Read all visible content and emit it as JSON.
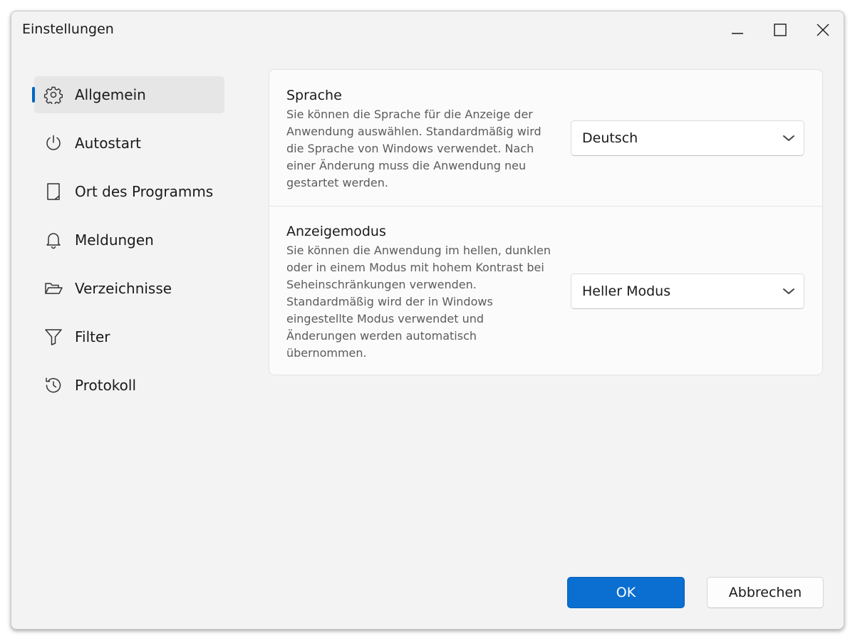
{
  "window": {
    "title": "Einstellungen"
  },
  "sidebar": {
    "items": [
      {
        "label": "Allgemein",
        "icon": "gear-icon",
        "active": true
      },
      {
        "label": "Autostart",
        "icon": "power-icon",
        "active": false
      },
      {
        "label": "Ort des Programms",
        "icon": "document-icon",
        "active": false
      },
      {
        "label": "Meldungen",
        "icon": "bell-icon",
        "active": false
      },
      {
        "label": "Verzeichnisse",
        "icon": "folder-open-icon",
        "active": false
      },
      {
        "label": "Filter",
        "icon": "filter-icon",
        "active": false
      },
      {
        "label": "Protokoll",
        "icon": "history-icon",
        "active": false
      }
    ]
  },
  "settings": {
    "language": {
      "title": "Sprache",
      "description": "Sie können die Sprache für die Anzeige der Anwendung auswählen. Standardmäßig wird die Sprache von Windows verwendet. Nach einer Änderung muss die Anwendung neu gestartet werden.",
      "value": "Deutsch"
    },
    "display_mode": {
      "title": "Anzeigemodus",
      "description": "Sie können die Anwendung im hellen, dunklen oder in einem Modus mit hohem Kontrast bei Seheinschränkungen verwenden. Standardmäßig wird der in Windows eingestellte Modus verwendet und Änderungen werden automatisch übernommen.",
      "value": "Heller Modus"
    }
  },
  "footer": {
    "ok_label": "OK",
    "cancel_label": "Abbrechen"
  },
  "colors": {
    "accent": "#0067c0",
    "ok_button": "#0a6fd0",
    "window_background": "#f3f3f3",
    "card_background": "#fbfbfb"
  }
}
